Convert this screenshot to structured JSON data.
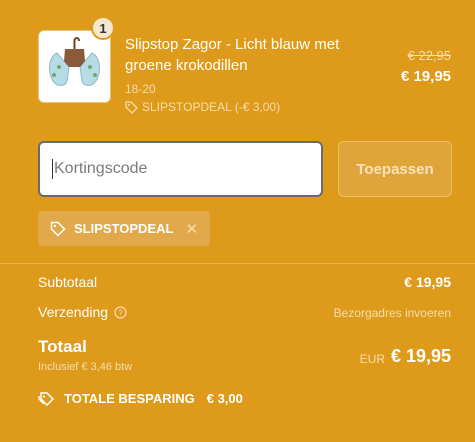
{
  "product": {
    "quantity": "1",
    "title": "Slipstop Zagor - Licht blauw met groene krokodillen",
    "variant": "18-20",
    "discount_applied": "SLIPSTOPDEAL (-€ 3,00)",
    "old_price": "€ 22,95",
    "price": "€ 19,95"
  },
  "discount": {
    "placeholder": "Kortingscode",
    "apply_label": "Toepassen",
    "code_chip": "SLIPSTOPDEAL"
  },
  "summary": {
    "subtotal_label": "Subtotaal",
    "subtotal_value": "€ 19,95",
    "shipping_label": "Verzending",
    "shipping_value": "Bezorgadres invoeren",
    "total_label": "Totaal",
    "tax_note": "Inclusief € 3,46 btw",
    "currency": "EUR",
    "total_value": "€ 19,95",
    "savings_label": "TOTALE BESPARING",
    "savings_value": "€ 3,00"
  },
  "colors": {
    "background": "#DE9A1A",
    "text": "#FFFFFF"
  }
}
